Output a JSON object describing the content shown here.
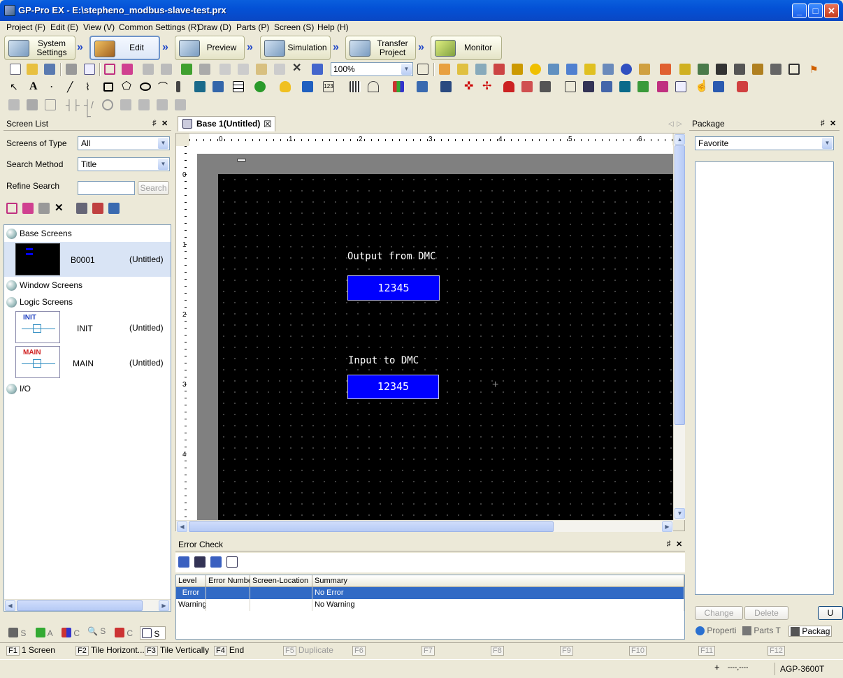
{
  "window": {
    "title": "GP-Pro EX - E:\\stepheno_modbus-slave-test.prx",
    "minimize": "_",
    "maximize": "□",
    "close": "✕"
  },
  "menu": [
    "Project (F)",
    "Edit (E)",
    "View (V)",
    "Common Settings (R)",
    "Draw (D)",
    "Parts (P)",
    "Screen (S)",
    "Help (H)"
  ],
  "workflow": {
    "system_settings": "System\nSettings",
    "edit": "Edit",
    "preview": "Preview",
    "simulation": "Simulation",
    "transfer_project": "Transfer\nProject",
    "monitor": "Monitor",
    "arrow": "»"
  },
  "zoom": "100%",
  "screen_list": {
    "title": "Screen List",
    "screens_of_type_label": "Screens of Type",
    "screens_of_type_value": "All",
    "search_method_label": "Search Method",
    "search_method_value": "Title",
    "refine_search_label": "Refine Search",
    "search_button": "Search",
    "tree": {
      "base_screens": "Base Screens",
      "base_items": [
        {
          "id": "B0001",
          "title": "(Untitled)"
        }
      ],
      "window_screens": "Window Screens",
      "logic_screens": "Logic Screens",
      "logic_items": [
        {
          "id": "INIT",
          "title": "(Untitled)",
          "thumb_label": "INIT"
        },
        {
          "id": "MAIN",
          "title": "(Untitled)",
          "thumb_label": "MAIN"
        }
      ],
      "io": "I/O"
    },
    "bottom_tabs": [
      "S",
      "A",
      "C",
      "S",
      "C",
      "S"
    ]
  },
  "editor": {
    "tab_title": "Base 1(Untitled)",
    "tab_close": "☒",
    "h_ruler": [
      "0",
      "1",
      "2",
      "3",
      "4",
      "5",
      "6"
    ],
    "v_ruler": [
      "0",
      "1",
      "2",
      "3",
      "4"
    ],
    "output_label": "Output from DMC",
    "output_value": "12345",
    "input_label": "Input to DMC",
    "input_value": "12345"
  },
  "package": {
    "title": "Package",
    "filter": "Favorite",
    "change_button": "Change",
    "delete_button": "Delete",
    "u_button": "U",
    "tabs": [
      "Properti",
      "Parts T",
      "Packag"
    ]
  },
  "error_check": {
    "title": "Error Check",
    "columns": [
      "Level",
      "Error Numbe",
      "Screen-Location",
      "Summary"
    ],
    "rows": [
      {
        "level": "Error",
        "number": "",
        "location": "",
        "summary": "No Error"
      },
      {
        "level": "Warning",
        "number": "",
        "location": "",
        "summary": "No Warning"
      }
    ]
  },
  "fkeys": [
    {
      "key": "F1",
      "label": "1 Screen",
      "enabled": true
    },
    {
      "key": "F2",
      "label": "Tile Horizont...",
      "enabled": true
    },
    {
      "key": "F3",
      "label": "Tile Vertically",
      "enabled": true
    },
    {
      "key": "F4",
      "label": "End",
      "enabled": true
    },
    {
      "key": "F5",
      "label": "Duplicate",
      "enabled": false
    },
    {
      "key": "F6",
      "label": "",
      "enabled": false
    },
    {
      "key": "F7",
      "label": "",
      "enabled": false
    },
    {
      "key": "F8",
      "label": "",
      "enabled": false
    },
    {
      "key": "F9",
      "label": "",
      "enabled": false
    },
    {
      "key": "F10",
      "label": "",
      "enabled": false
    },
    {
      "key": "F11",
      "label": "",
      "enabled": false
    },
    {
      "key": "F12",
      "label": "",
      "enabled": false
    }
  ],
  "status": {
    "coords": "----,----",
    "model": "AGP-3600T"
  },
  "colors": {
    "display_blue": "#0000ff",
    "selection": "#316ac5",
    "titlebar": "#0451d6"
  }
}
